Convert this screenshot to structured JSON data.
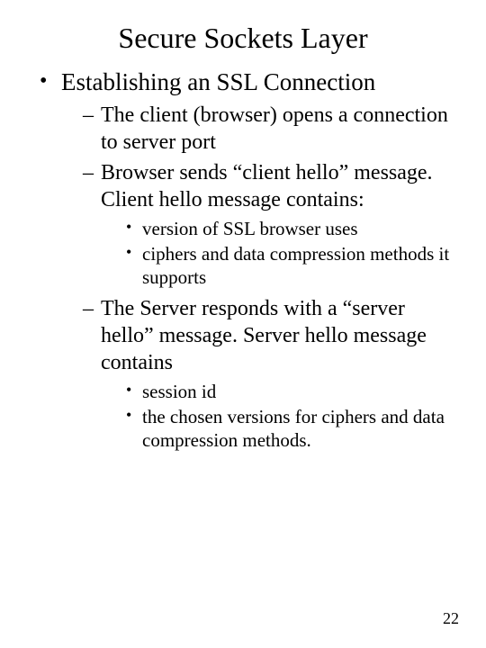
{
  "title": "Secure Sockets Layer",
  "l1": {
    "item0": "Establishing an SSL Connection"
  },
  "l2": {
    "item0": "The client (browser) opens a connection to server port",
    "item1": "Browser sends “client hello” message. Client hello message contains:",
    "item2": "The Server responds with a “server hello” message.  Server hello message contains"
  },
  "l3a": {
    "item0": "version of SSL browser uses",
    "item1": "ciphers and data compression methods it supports"
  },
  "l3b": {
    "item0": "session id",
    "item1": "the chosen versions for ciphers and data compression methods."
  },
  "pageNumber": "22"
}
